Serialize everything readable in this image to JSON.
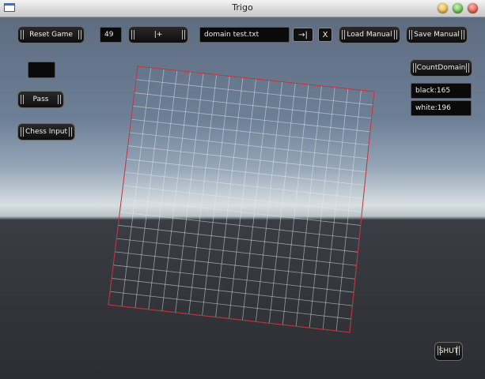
{
  "window": {
    "title": "Trigo"
  },
  "toolbar": {
    "reset_label": "Reset Game",
    "number_value": "49",
    "step_label": "|+",
    "filename_value": "domain test.txt",
    "jump_label": "→|",
    "clear_label": "X",
    "load_label": "Load Manual",
    "save_label": "Save Manual"
  },
  "left_panel": {
    "empty_box_value": "",
    "pass_label": "Pass",
    "chess_input_label": "Chess Input"
  },
  "right_panel": {
    "count_domain_label": "CountDomain",
    "black_count": "black:165",
    "white_count": "white:196"
  },
  "bottom": {
    "shut_label": "SHUT"
  },
  "colors": {
    "grid_line": "#e8ecf0",
    "board_border": "#c0303a",
    "black_stone": "#1c1c1c",
    "white_stone": "#f4f4f4"
  },
  "board": {
    "size": 19
  }
}
